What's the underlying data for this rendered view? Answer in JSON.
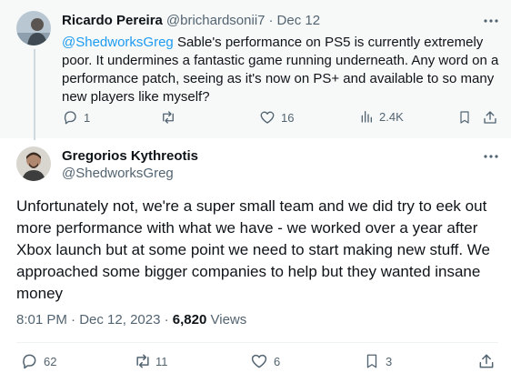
{
  "reply": {
    "author_name": "Ricardo Pereira",
    "author_handle": "@brichardsonii7",
    "separator": "·",
    "date": "Dec 12",
    "mention": "@ShedworksGreg",
    "text": " Sable's performance on PS5 is currently extremely poor. It undermines a fantastic game running underneath. Any word on a performance patch, seeing as it's now on PS+ and available to so many new players like myself?",
    "stats": {
      "replies": "1",
      "likes": "16",
      "views": "2.4K"
    }
  },
  "main": {
    "author_name": "Gregorios Kythreotis",
    "author_handle": "@ShedworksGreg",
    "text": "Unfortunately not, we're a super small team and we did try to eek out more performance with what we have - we worked over a year after Xbox launch but at some point we need to start making new stuff. We approached some bigger companies to help but they wanted insane money",
    "time": "8:01 PM",
    "dot": "·",
    "date": "Dec 12, 2023",
    "views_count": "6,820",
    "views_label": "Views",
    "stats": {
      "replies": "62",
      "reposts": "11",
      "likes": "6",
      "bookmarks": "3"
    }
  },
  "colors": {
    "text": "#0f1419",
    "muted": "#536471",
    "link": "#1d9bf0",
    "thread_line": "#cfd9de"
  }
}
